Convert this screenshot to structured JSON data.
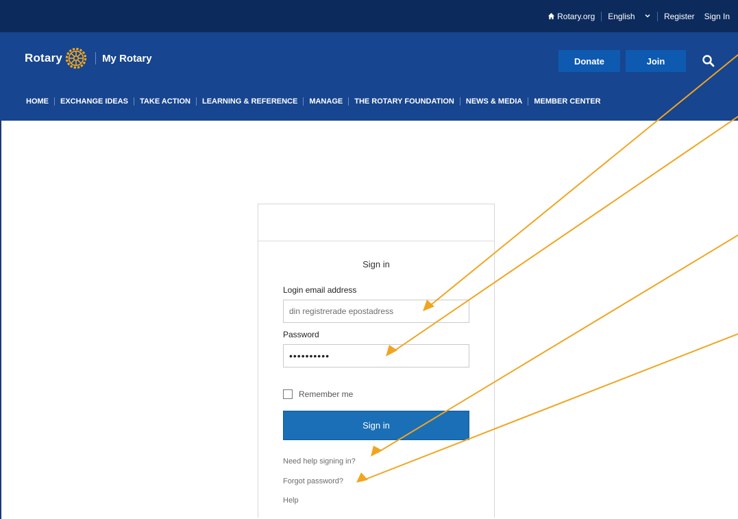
{
  "utility": {
    "rotary_org": "Rotary.org",
    "language": "English",
    "register": "Register",
    "sign_in": "Sign In"
  },
  "header": {
    "logo_word": "Rotary",
    "my_rotary": "My Rotary",
    "donate": "Donate",
    "join": "Join"
  },
  "nav": {
    "items": [
      "HOME",
      "EXCHANGE IDEAS",
      "TAKE ACTION",
      "LEARNING & REFERENCE",
      "MANAGE",
      "THE ROTARY FOUNDATION",
      "NEWS & MEDIA",
      "MEMBER CENTER"
    ]
  },
  "signin": {
    "title": "Sign in",
    "email_label": "Login email address",
    "email_placeholder": "din registrerade epostadress",
    "password_label": "Password",
    "password_value": "••••••••••",
    "remember": "Remember me",
    "button": "Sign in",
    "need_help": "Need help signing in?",
    "forgot": "Forgot password?",
    "help": "Help"
  },
  "colors": {
    "utility_bar": "#0c2a5c",
    "header": "#17458f",
    "button_blue": "#0d5ab0",
    "signin_button": "#1a6fb7",
    "annotation_arrow": "#f0a521"
  }
}
